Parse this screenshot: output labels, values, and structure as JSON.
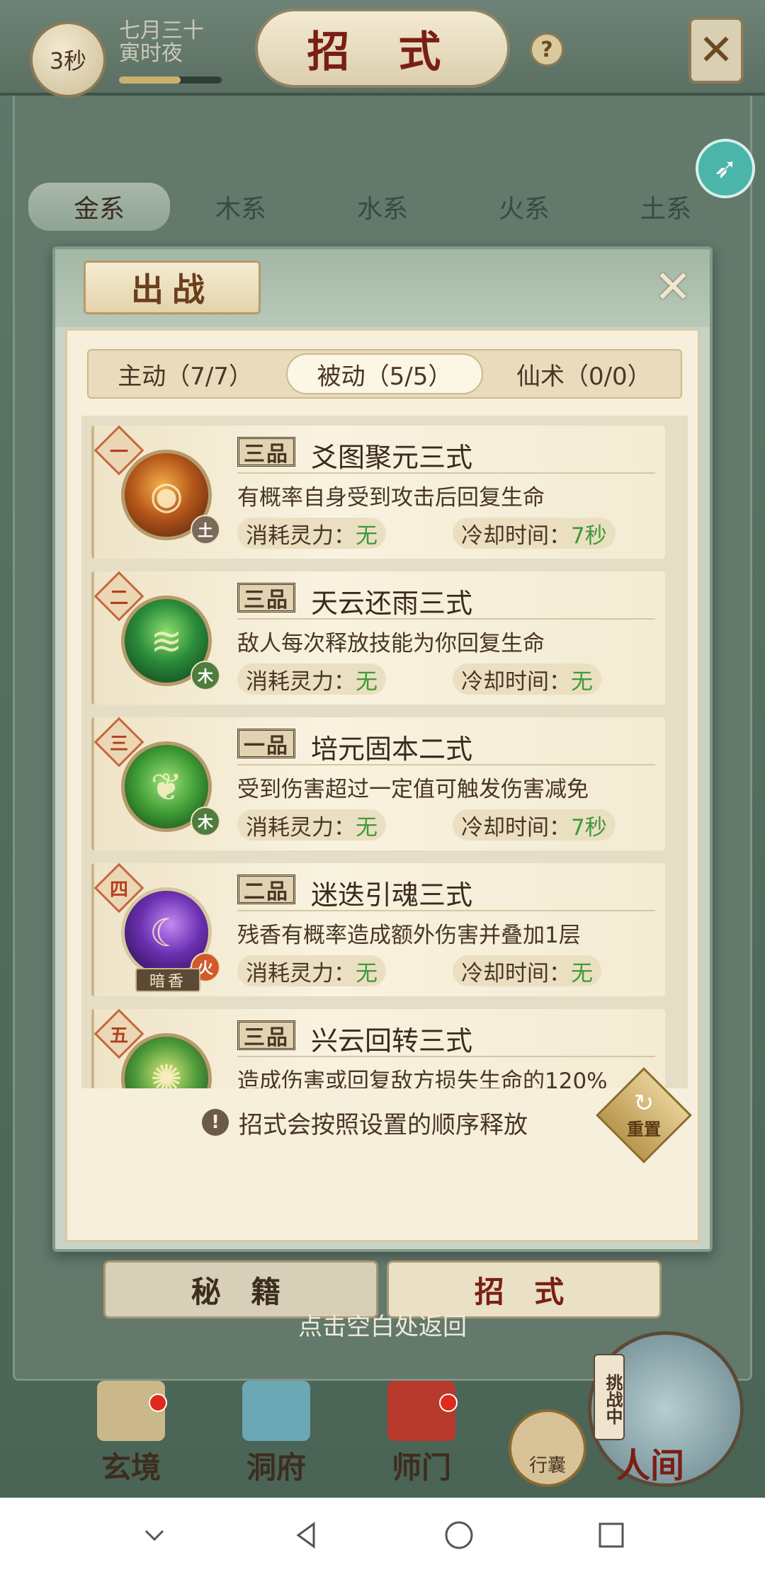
{
  "status": {
    "timer": "3秒",
    "lunar_date": "七月三十",
    "lunar_time": "寅时夜",
    "time_progress": 0.6
  },
  "header": {
    "title": "招 式"
  },
  "element_tabs": [
    {
      "label": "金系",
      "active": true
    },
    {
      "label": "木系",
      "active": false
    },
    {
      "label": "水系",
      "active": false
    },
    {
      "label": "火系",
      "active": false
    },
    {
      "label": "土系",
      "active": false
    }
  ],
  "modal": {
    "title": "出战",
    "sub_tabs": [
      {
        "label": "主动（7/7）",
        "active": false
      },
      {
        "label": "被动（5/5）",
        "active": true
      },
      {
        "label": "仙术（0/0）",
        "active": false
      }
    ],
    "cost_label": "消耗灵力：",
    "cd_label": "冷却时间：",
    "skills": [
      {
        "order": "一",
        "grade": "三品",
        "name": "爻图聚元三式",
        "desc": "有概率自身受到攻击后回复生命",
        "cost": "无",
        "cooldown": "7秒",
        "element": "土",
        "icon": "cauldron-icon"
      },
      {
        "order": "二",
        "grade": "三品",
        "name": "天云还雨三式",
        "desc": "敌人每次释放技能为你回复生命",
        "cost": "无",
        "cooldown": "无",
        "element": "木",
        "icon": "scroll-icon"
      },
      {
        "order": "三",
        "grade": "一品",
        "name": "培元固本二式",
        "desc": "受到伤害超过一定值可触发伤害减免",
        "cost": "无",
        "cooldown": "7秒",
        "element": "木",
        "icon": "sprout-icon"
      },
      {
        "order": "四",
        "grade": "二品",
        "name": "迷迭引魂三式",
        "desc": "残香有概率造成额外伤害并叠加1层",
        "cost": "无",
        "cooldown": "无",
        "element": "火",
        "icon": "character-portrait-icon",
        "character_name": "暗香"
      },
      {
        "order": "五",
        "grade": "三品",
        "name": "兴云回转三式",
        "desc": "造成伤害或回复敌方损失生命的120%",
        "cost": "",
        "cooldown": "",
        "element": "",
        "icon": "compass-icon"
      }
    ],
    "tip": "招式会按照设置的顺序释放",
    "reset_label": "重置"
  },
  "bottom_tabs": [
    {
      "label": "秘 籍",
      "active": false
    },
    {
      "label": "招 式",
      "active": true
    }
  ],
  "return_hint": "点击空白处返回",
  "nav": {
    "xuanjing": "玄境",
    "dongfu": "洞府",
    "shimen": "师门",
    "bag": "行囊",
    "challenge": "挑战中",
    "renjian": "人间"
  },
  "colors": {
    "accent_red": "#7a1f14",
    "value_green": "#3e9a3a",
    "parchment": "#f6efdc"
  }
}
